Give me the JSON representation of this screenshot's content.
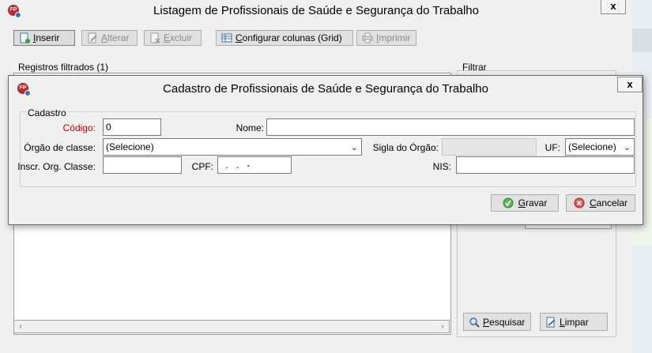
{
  "main_window": {
    "title": "Listagem de Profissionais de Saúde e Segurança do Trabalho",
    "close_glyph": "x",
    "logo_text": "FP",
    "toolbar": {
      "inserir": {
        "u": "I",
        "rest": "nserir"
      },
      "alterar": {
        "u": "A",
        "rest": "lterar"
      },
      "excluir": {
        "u": "E",
        "rest": "xcluir"
      },
      "configurar": {
        "u": "C",
        "rest": "onfigurar colunas (Grid)"
      },
      "imprimir": {
        "u": "I",
        "rest": "mprimir"
      }
    },
    "records_label": "Registros filtrados (1)",
    "filter_label": "Filtrar",
    "pesquisar": {
      "u": "P",
      "rest": "esquisar"
    },
    "limpar": {
      "u": "L",
      "rest": "impar"
    }
  },
  "dialog": {
    "title": "Cadastro de Profissionais de Saúde e Segurança do Trabalho",
    "close_glyph": "x",
    "logo_text": "FP",
    "group_label": "Cadastro",
    "fields": {
      "codigo": {
        "label": "Código:",
        "value": "0"
      },
      "nome": {
        "label": "Nome:",
        "value": ""
      },
      "orgao": {
        "label": "Órgão de classe:",
        "value": "(Selecione)"
      },
      "sigla": {
        "label": "Sigla do Órgão:",
        "value": ""
      },
      "uf": {
        "label": "UF:",
        "value": "(Selecione)"
      },
      "inscr": {
        "label": "Inscr. Org. Classe:",
        "value": ""
      },
      "cpf": {
        "label": "CPF:",
        "value": "  .   .   -"
      },
      "nis": {
        "label": "NIS:",
        "value": ""
      }
    },
    "gravar": {
      "u": "G",
      "rest": "ravar"
    },
    "cancelar": {
      "u": "C",
      "rest": "ancelar"
    }
  },
  "colors": {
    "required_label": "#c00000",
    "logo": "#c0272d"
  }
}
